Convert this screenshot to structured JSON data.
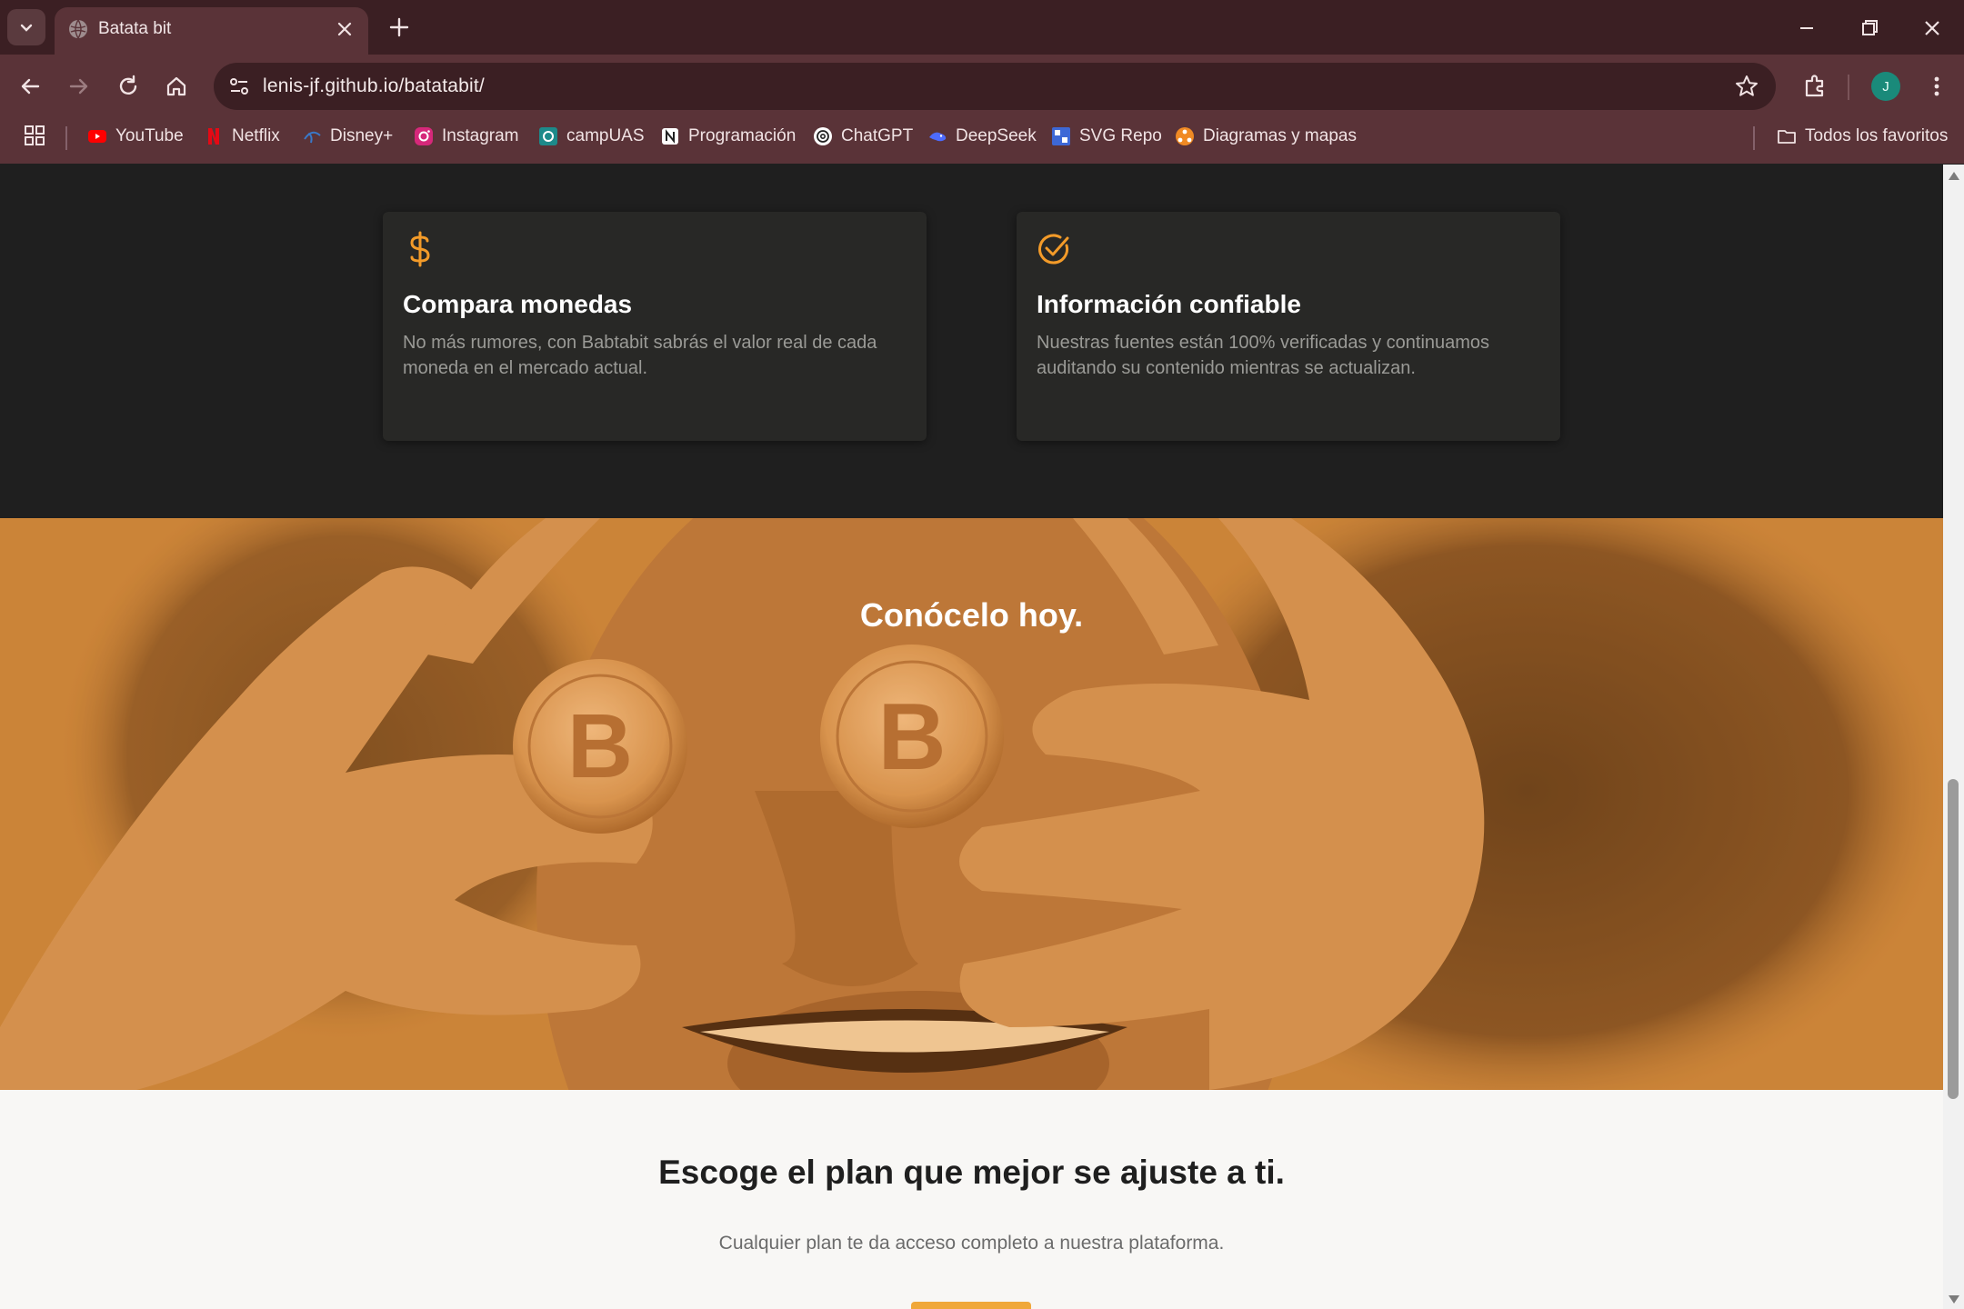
{
  "browser": {
    "tab_title": "Batata bit",
    "url": "lenis-jf.github.io/batatabit/",
    "avatar_letter": "J",
    "accent": "#5a3338",
    "bookmarks": [
      {
        "label": "YouTube",
        "icon": "youtube-icon"
      },
      {
        "label": "Netflix",
        "icon": "netflix-icon"
      },
      {
        "label": "Disney+",
        "icon": "disney-icon"
      },
      {
        "label": "Instagram",
        "icon": "instagram-icon"
      },
      {
        "label": "campUAS",
        "icon": "campuas-icon"
      },
      {
        "label": "Programación",
        "icon": "notion-icon"
      },
      {
        "label": "ChatGPT",
        "icon": "chatgpt-icon"
      },
      {
        "label": "DeepSeek",
        "icon": "deepseek-icon"
      },
      {
        "label": "SVG Repo",
        "icon": "svgrepo-icon"
      },
      {
        "label": "Diagramas y mapas",
        "icon": "diagrams-icon"
      }
    ],
    "all_bookmarks": "Todos los favoritos"
  },
  "features": {
    "accent": "#f39b29",
    "cards": [
      {
        "icon": "dollar-icon",
        "title": "Compara monedas",
        "text": "No más rumores, con Babtabit sabrás el valor real de cada moneda en el mercado actual."
      },
      {
        "icon": "check-circle-icon",
        "title": "Información confiable",
        "text": "Nuestras fuentes están 100% verificadas y continuamos auditando su contenido mientras se actualizan."
      }
    ]
  },
  "hero": {
    "title": "Conócelo hoy."
  },
  "plans": {
    "title": "Escoge el plan que mejor se ajuste a ti.",
    "subtitle": "Cualquier plan te da acceso completo a nuestra plataforma."
  }
}
